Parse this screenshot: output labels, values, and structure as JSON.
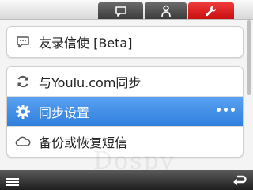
{
  "tabs": [
    {
      "icon": "chat-icon",
      "active": false
    },
    {
      "icon": "user-icon",
      "active": false
    },
    {
      "icon": "wrench-icon",
      "active": true
    }
  ],
  "cards": {
    "messenger": {
      "label": "友录信使  [Beta]",
      "icon": "chat-bubble-icon"
    },
    "sync": {
      "label": "与Youlu.com同步",
      "icon": "refresh-icon"
    },
    "settings": {
      "label": "同步设置",
      "icon": "gear-icon"
    },
    "backup": {
      "label": "备份或恢复短信",
      "icon": "cloud-icon"
    }
  },
  "colors": {
    "accent": "#2f7fdd",
    "active_tab": "#e02222"
  }
}
